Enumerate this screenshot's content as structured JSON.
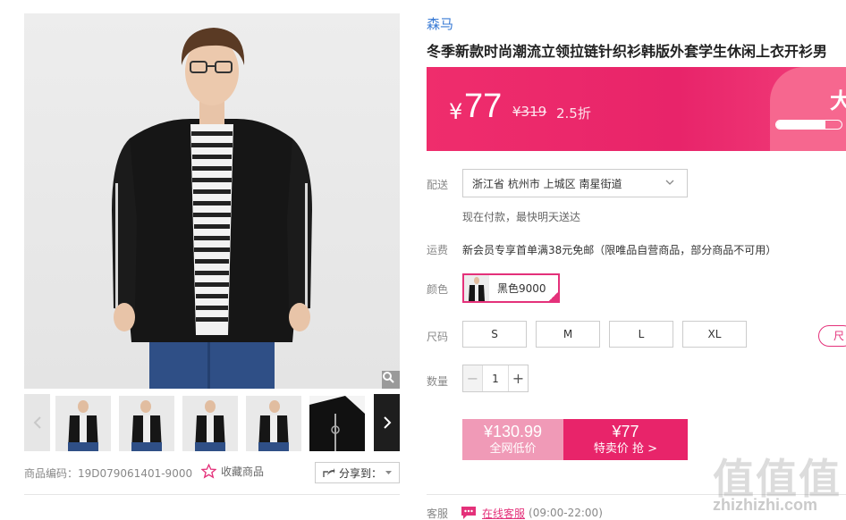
{
  "product": {
    "brand": "森马",
    "title": "冬季新款时尚潮流立领拉链针织衫韩版外套学生休闲上衣开衫男",
    "sku_text": "商品编码：19D079061401-9000"
  },
  "actions": {
    "favorite_label": "收藏商品",
    "share_label": "分享到："
  },
  "price": {
    "currency": "¥",
    "current": "77",
    "original": "¥319",
    "discount": "2.5折",
    "promo_fragment": "大",
    "stock_progress": 0.75
  },
  "delivery": {
    "label": "配送",
    "location": "浙江省 杭州市 上城区 南星街道",
    "note": "现在付款，最快明天送达"
  },
  "shipping": {
    "label": "运费",
    "text": "新会员专享首单满38元免邮（限唯品自营商品，部分商品不可用）"
  },
  "color": {
    "label": "颜色",
    "selected": "黑色9000"
  },
  "size": {
    "label": "尺码",
    "options": [
      "S",
      "M",
      "L",
      "XL"
    ],
    "guide_fragment": "尺"
  },
  "quantity": {
    "label": "数量",
    "value": "1",
    "minus": "−",
    "plus": "+"
  },
  "buy": {
    "all_price": "¥130.99",
    "all_label": "全网低价",
    "sale_price": "¥77",
    "sale_label": "特卖价 抢 >"
  },
  "service": {
    "label": "客服",
    "chat_label": "在线客服",
    "hours": "(09:00-22:00)"
  },
  "watermark": {
    "chars": "值值值",
    "url": "zhizhizhi.com"
  },
  "colors": {
    "accent": "#e8246a",
    "brand_link": "#3a7bd5"
  }
}
